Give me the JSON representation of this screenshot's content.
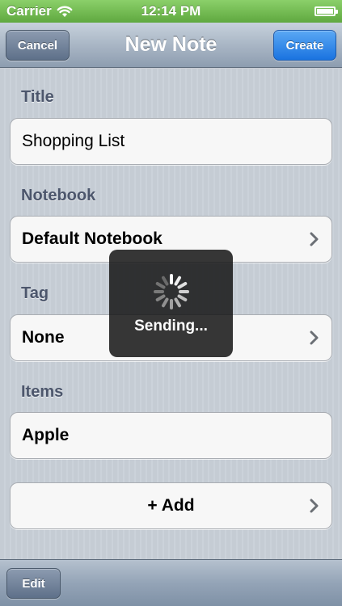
{
  "status_bar": {
    "carrier": "Carrier",
    "time": "12:14 PM",
    "signal_icon": "wifi-icon",
    "battery_icon": "battery-full-icon"
  },
  "nav_bar": {
    "title": "New Note",
    "cancel_label": "Cancel",
    "create_label": "Create"
  },
  "form": {
    "title_section": {
      "label": "Title",
      "value": "Shopping List"
    },
    "notebook_section": {
      "label": "Notebook",
      "value": "Default Notebook"
    },
    "tag_section": {
      "label": "Tag",
      "value": "None"
    },
    "items_section": {
      "label": "Items",
      "items": [
        "Apple"
      ],
      "add_label": "+ Add"
    }
  },
  "hud": {
    "text": "Sending...",
    "icon": "spinner-icon"
  },
  "toolbar": {
    "edit_label": "Edit"
  },
  "colors": {
    "status_bar": "#6bb84a",
    "create_button": "#2a80ea",
    "section_label": "#4c566c"
  }
}
